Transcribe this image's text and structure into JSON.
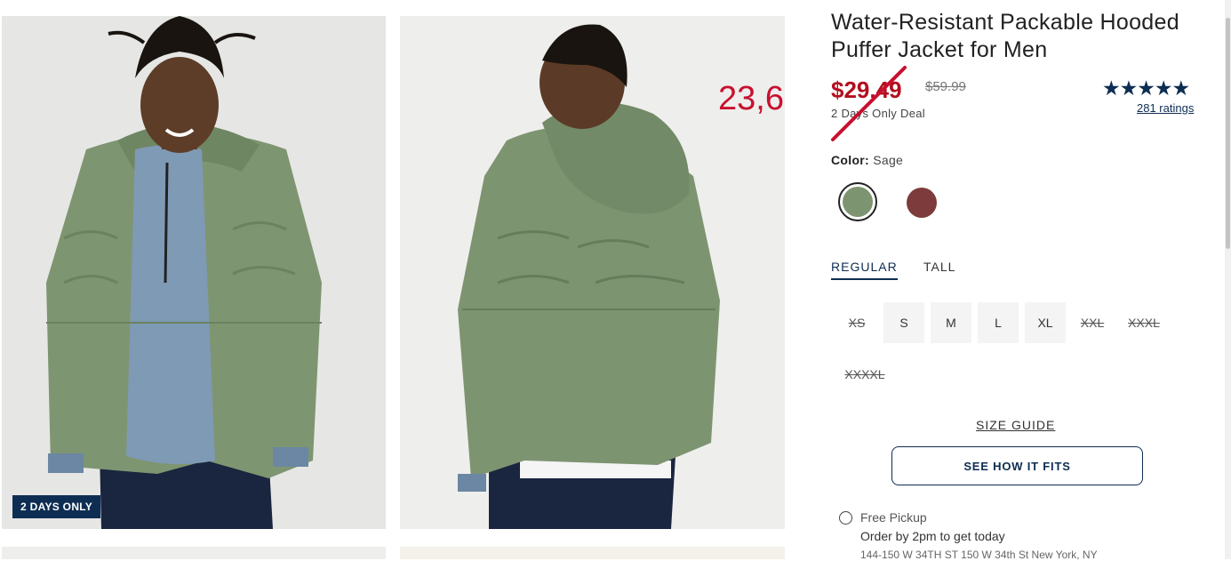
{
  "product": {
    "title": "Water-Resistant Packable Hooded Puffer Jacket for Men",
    "sale_price": "$29.49",
    "original_price": "$59.99",
    "deal_text": "2 Days Only Deal",
    "rating_stars": "★★★★★",
    "rating_value": 5,
    "ratings_link": "281 ratings"
  },
  "gallery": {
    "badge": "2 DAYS ONLY",
    "overlay_number": "23,6"
  },
  "color": {
    "label": "Color:",
    "selected": "Sage",
    "swatches": [
      {
        "name": "Sage",
        "hex": "#7d9470",
        "selected": true
      },
      {
        "name": "Brown",
        "hex": "#7d3b3b",
        "selected": false
      }
    ]
  },
  "fit_tabs": [
    {
      "label": "REGULAR",
      "active": true
    },
    {
      "label": "TALL",
      "active": false
    }
  ],
  "sizes": [
    {
      "label": "XS",
      "available": false
    },
    {
      "label": "S",
      "available": true
    },
    {
      "label": "M",
      "available": true
    },
    {
      "label": "L",
      "available": true
    },
    {
      "label": "XL",
      "available": true
    },
    {
      "label": "XXL",
      "available": false
    },
    {
      "label": "XXXL",
      "available": false
    },
    {
      "label": "XXXXL",
      "available": false
    }
  ],
  "size_guide": "SIZE GUIDE",
  "see_how_it_fits": "SEE HOW IT FITS",
  "pickup": {
    "title": "Free Pickup",
    "note": "Order by 2pm to get today",
    "address": "144-150 W 34TH ST 150 W 34th St New York, NY"
  },
  "colors": {
    "accent": "#0e2d52",
    "sale_red": "#b20f1e",
    "overlay_red": "#c8102e"
  }
}
